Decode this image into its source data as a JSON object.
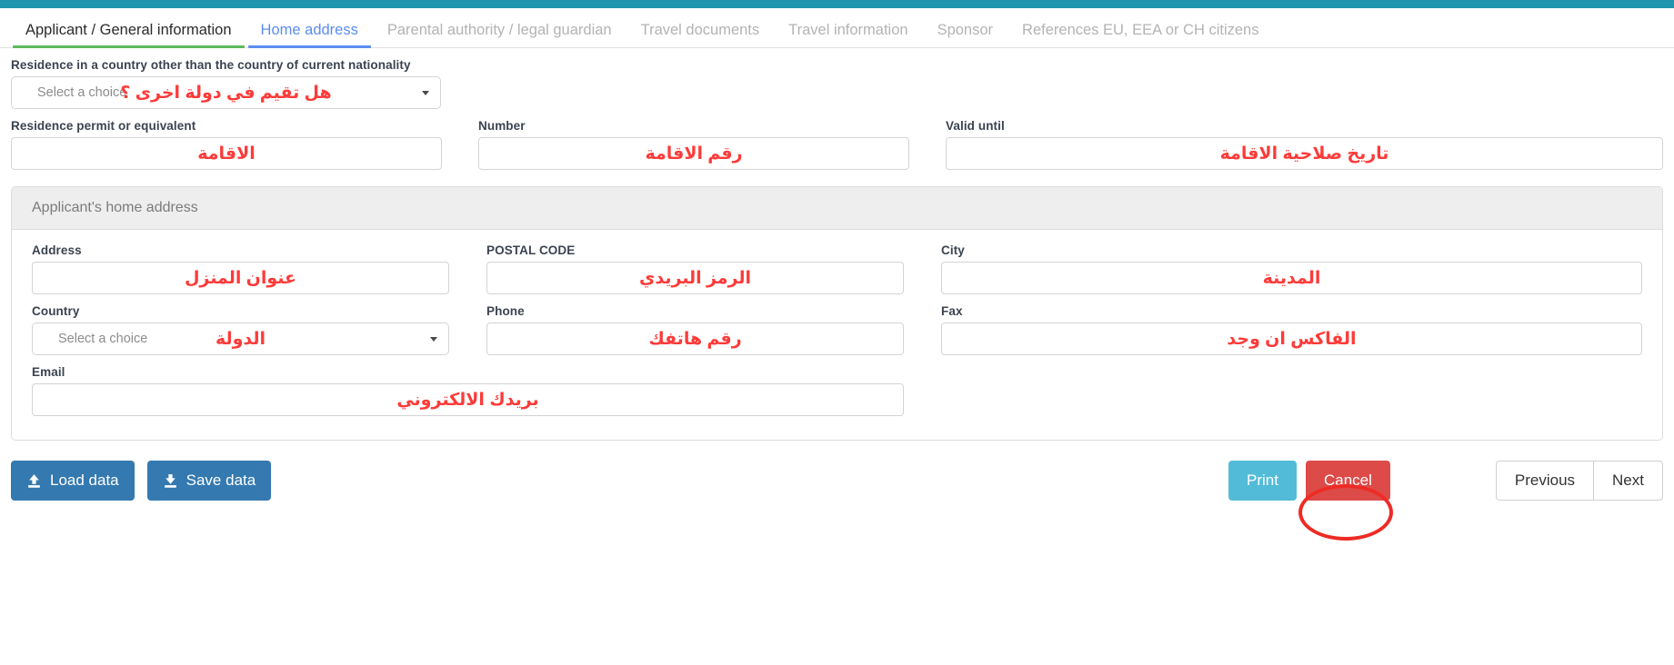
{
  "theme": {
    "topbar_color": "#2196ad",
    "active_tab_color": "#5b8dee",
    "done_tab_color": "#5cb85c",
    "annotation_color": "#fc3b39",
    "highlight_color": "#ee2b24"
  },
  "tabs": [
    {
      "label": "Applicant / General information",
      "state": "done"
    },
    {
      "label": "Home address",
      "state": "active"
    },
    {
      "label": "Parental authority / legal guardian",
      "state": "idle"
    },
    {
      "label": "Travel documents",
      "state": "idle"
    },
    {
      "label": "Travel information",
      "state": "idle"
    },
    {
      "label": "Sponsor",
      "state": "idle"
    },
    {
      "label": "References EU, EEA or CH citizens",
      "state": "idle"
    }
  ],
  "residence": {
    "question_label": "Residence in a country other than the country of current nationality",
    "select_placeholder": "Select a choice",
    "select_annotation": "هل تقيم في دولة اخرى ؟",
    "permit_label": "Residence permit or equivalent",
    "permit_value": "",
    "permit_annotation": "الاقامة",
    "number_label": "Number",
    "number_value": "",
    "number_annotation": "رقم الاقامة",
    "valid_until_label": "Valid until",
    "valid_until_value": "",
    "valid_until_annotation": "تاريخ صلاحية الاقامة"
  },
  "home_address": {
    "panel_title": "Applicant's home address",
    "address_label": "Address",
    "address_value": "",
    "address_annotation": "عنوان المنزل",
    "postal_label": "POSTAL CODE",
    "postal_value": "",
    "postal_annotation": "الرمز البريدي",
    "city_label": "City",
    "city_value": "",
    "city_annotation": "المدينة",
    "country_label": "Country",
    "country_placeholder": "Select a choice",
    "country_annotation": "الدولة",
    "phone_label": "Phone",
    "phone_value": "",
    "phone_annotation": "رقم هاتفك",
    "fax_label": "Fax",
    "fax_value": "",
    "fax_annotation": "الفاكس ان وجد",
    "email_label": "Email",
    "email_value": "",
    "email_annotation": "بريدك الالكتروني"
  },
  "footer": {
    "load_label": "Load data",
    "save_label": "Save data",
    "print_label": "Print",
    "cancel_label": "Cancel",
    "previous_label": "Previous",
    "next_label": "Next",
    "load_icon": "upload-icon",
    "save_icon": "download-icon"
  }
}
